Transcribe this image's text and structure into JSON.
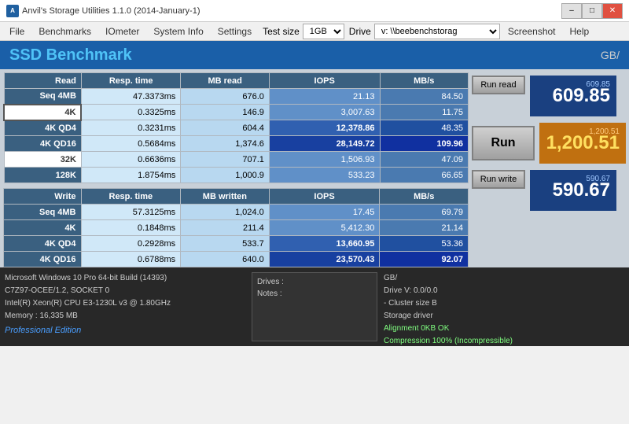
{
  "titleBar": {
    "title": "Anvil's Storage Utilities 1.1.0 (2014-January-1)",
    "minBtn": "–",
    "maxBtn": "□",
    "closeBtn": "✕"
  },
  "menuBar": {
    "file": "File",
    "benchmarks": "Benchmarks",
    "iometer": "IOmeter",
    "systemInfo": "System Info",
    "settings": "Settings",
    "testSizeLabel": "Test size",
    "testSizeValue": "1GB",
    "driveLabel": "Drive",
    "driveValue": "v: \\\\beebenchstorag",
    "screenshot": "Screenshot",
    "help": "Help"
  },
  "header": {
    "title": "SSD Benchmark",
    "unit": "GB/"
  },
  "readTable": {
    "headers": [
      "Read",
      "Resp. time",
      "MB read",
      "IOPS",
      "MB/s"
    ],
    "rows": [
      {
        "label": "Seq 4MB",
        "resp": "47.3373ms",
        "mb": "676.0",
        "iops": "21.13",
        "mbs": "84.50"
      },
      {
        "label": "4K",
        "resp": "0.3325ms",
        "mb": "146.9",
        "iops": "3,007.63",
        "mbs": "11.75"
      },
      {
        "label": "4K QD4",
        "resp": "0.3231ms",
        "mb": "604.4",
        "iops": "12,378.86",
        "mbs": "48.35"
      },
      {
        "label": "4K QD16",
        "resp": "0.5684ms",
        "mb": "1,374.6",
        "iops": "28,149.72",
        "mbs": "109.96"
      },
      {
        "label": "32K",
        "resp": "0.6636ms",
        "mb": "707.1",
        "iops": "1,506.93",
        "mbs": "47.09"
      },
      {
        "label": "128K",
        "resp": "1.8754ms",
        "mb": "1,000.9",
        "iops": "533.23",
        "mbs": "66.65"
      }
    ]
  },
  "writeTable": {
    "headers": [
      "Write",
      "Resp. time",
      "MB written",
      "IOPS",
      "MB/s"
    ],
    "rows": [
      {
        "label": "Seq 4MB",
        "resp": "57.3125ms",
        "mb": "1,024.0",
        "iops": "17.45",
        "mbs": "69.79"
      },
      {
        "label": "4K",
        "resp": "0.1848ms",
        "mb": "211.4",
        "iops": "5,412.30",
        "mbs": "21.14"
      },
      {
        "label": "4K QD4",
        "resp": "0.2928ms",
        "mb": "533.7",
        "iops": "13,660.95",
        "mbs": "53.36"
      },
      {
        "label": "4K QD16",
        "resp": "0.6788ms",
        "mb": "640.0",
        "iops": "23,570.43",
        "mbs": "92.07"
      }
    ]
  },
  "scores": {
    "runReadSmall": "609.85",
    "runReadLarge": "609.85",
    "totalSmall": "1,200.51",
    "totalLarge": "1,200.51",
    "runWriteSmall": "590.67",
    "runWriteLarge": "590.67"
  },
  "buttons": {
    "runRead": "Run read",
    "run": "Run",
    "runWrite": "Run write"
  },
  "bottomInfo": {
    "line1": "Microsoft Windows 10 Pro 64-bit Build (14393)",
    "line2": "C7Z97-OCEE/1.2, SOCKET 0",
    "line3": "Intel(R) Xeon(R) CPU E3-1230L v3 @ 1.80GHz",
    "line4": "Memory : 16,335 MB",
    "proEdition": "Professional Edition",
    "drivesLabel": "Drives :",
    "notesLabel": "Notes :",
    "rightLine1": "GB/",
    "rightLine2": "Drive V: 0.0/0.0",
    "rightLine3": "- Cluster size B",
    "rightLine4": "Storage driver",
    "rightLine5": "",
    "rightLine6": "Alignment 0KB OK",
    "rightLine7": "Compression 100% (Incompressible)"
  }
}
